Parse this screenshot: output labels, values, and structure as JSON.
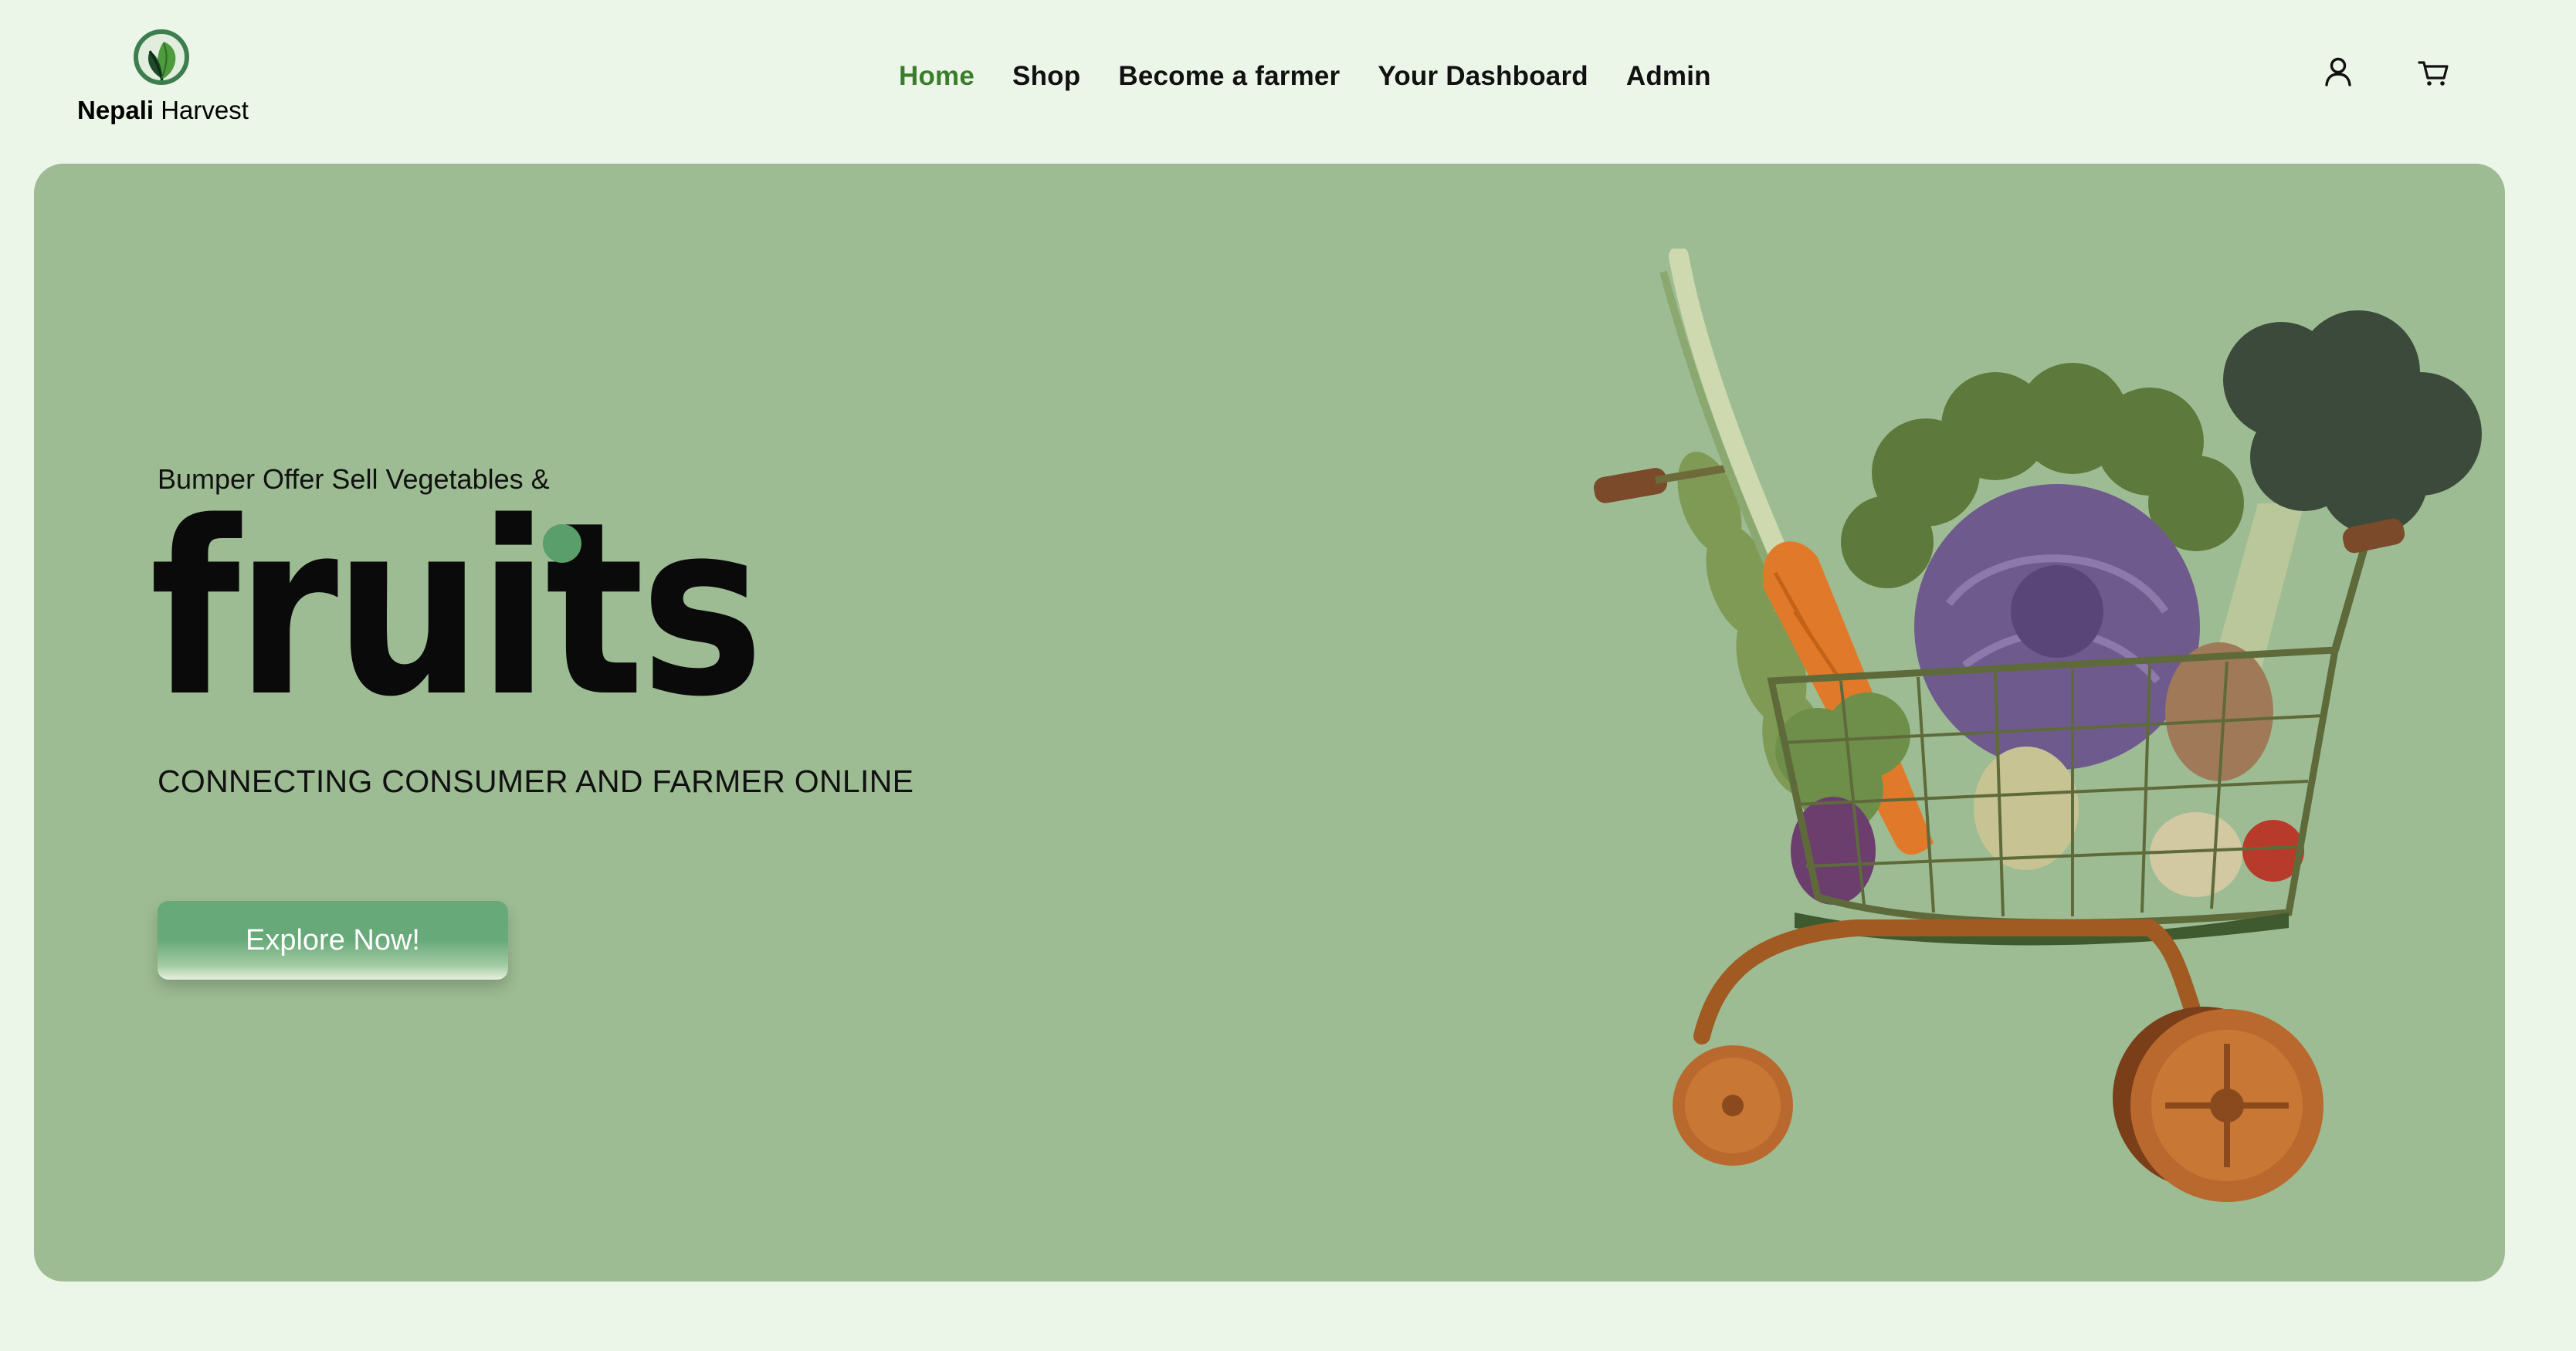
{
  "brand": {
    "name_bold": "Nepali",
    "name_rest": " Harvest",
    "logo_icon": "leaf-logo-icon",
    "accent_color": "#3b7d2c"
  },
  "nav": {
    "items": [
      {
        "label": "Home",
        "active": true
      },
      {
        "label": "Shop",
        "active": false
      },
      {
        "label": "Become a farmer",
        "active": false
      },
      {
        "label": "Your Dashboard",
        "active": false
      },
      {
        "label": "Admin",
        "active": false
      }
    ]
  },
  "header_icons": {
    "account": "user-icon",
    "cart": "shopping-cart-icon"
  },
  "hero": {
    "eyebrow": "Bumper Offer Sell Vegetables &",
    "headline": "fruits",
    "headline_dot_color": "#5a9e6c",
    "tagline": "CONNECTING CONSUMER AND FARMER ONLINE",
    "cta_label": "Explore Now!",
    "background_color": "#9dbc93",
    "image": "vegetable-shopping-cart"
  }
}
